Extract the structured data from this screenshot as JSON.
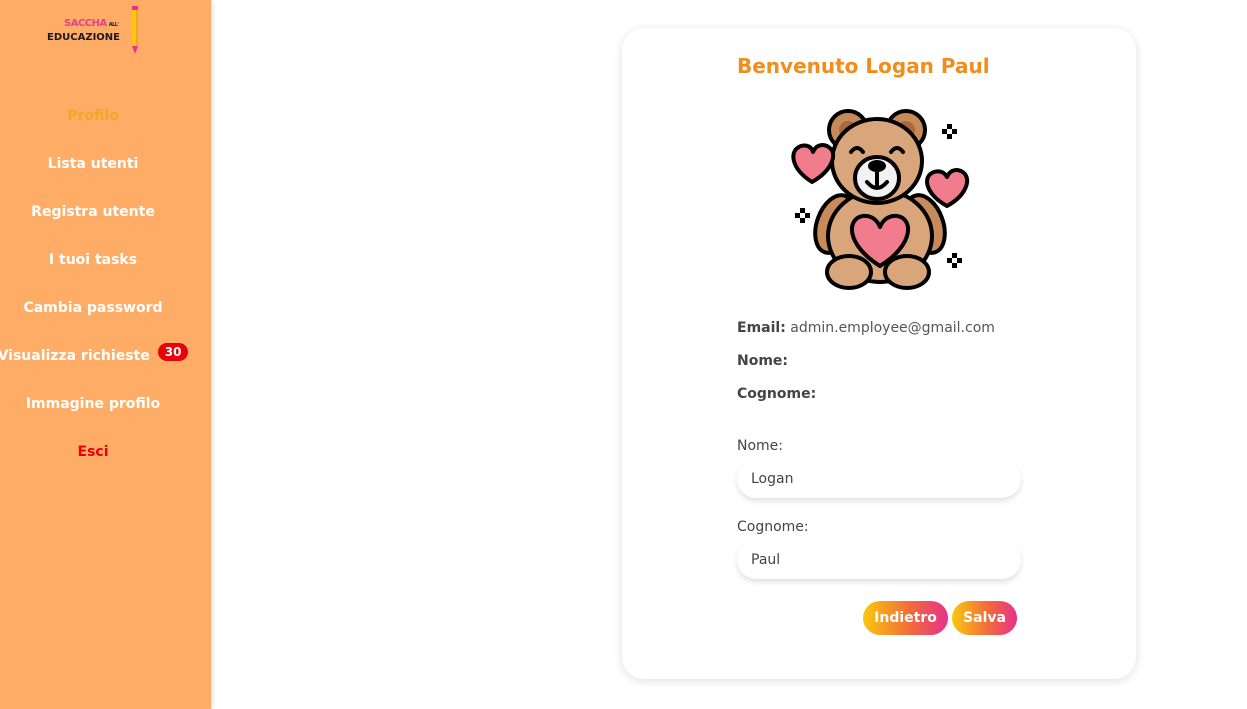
{
  "sidebar": {
    "logo": {
      "brand_top": "SACCHA",
      "brand_small": "ALL'",
      "brand_main": "EDUCAZIONE"
    },
    "items": [
      {
        "label": "Profilo"
      },
      {
        "label": "Lista utenti"
      },
      {
        "label": "Registra utente"
      },
      {
        "label": "I tuoi tasks"
      },
      {
        "label": "Cambia password"
      },
      {
        "label": "Visualizza richieste",
        "badge": "30"
      },
      {
        "label": "Immagine profilo"
      },
      {
        "label": "Esci"
      }
    ]
  },
  "main": {
    "welcome": "Benvenuto Logan Paul",
    "avatar_icon": "teddy-bear-hearts",
    "info": {
      "email_label": "Email:",
      "email_value": "admin.employee@gmail.com",
      "nome_label": "Nome:",
      "nome_value": "",
      "cognome_label": "Cognome:",
      "cognome_value": ""
    },
    "form": {
      "nome_label": "Nome:",
      "nome_value": "Logan",
      "cognome_label": "Cognome:",
      "cognome_value": "Paul"
    },
    "buttons": {
      "back": "Indietro",
      "save": "Salva"
    }
  },
  "colors": {
    "sidebar_bg": "#ffad66",
    "active": "#f5a623",
    "exit": "#e8000b",
    "welcome": "#f28c1c",
    "badge": "#e8000b"
  }
}
